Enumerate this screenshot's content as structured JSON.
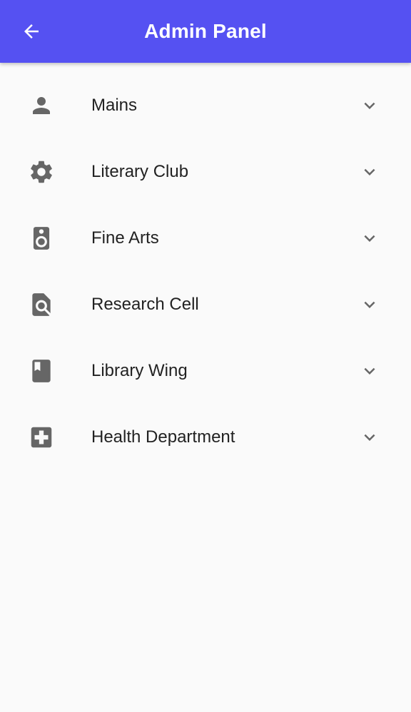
{
  "app_bar": {
    "title": "Admin Panel",
    "back_icon": "arrow-back-icon",
    "background": "#5551f2",
    "text_color": "#ffffff"
  },
  "menu": {
    "icon_color": "#666666",
    "items": [
      {
        "label": "Mains",
        "icon": "person-icon"
      },
      {
        "label": "Literary Club",
        "icon": "gear-icon"
      },
      {
        "label": "Fine Arts",
        "icon": "speaker-icon"
      },
      {
        "label": "Research Cell",
        "icon": "find-in-page-icon"
      },
      {
        "label": "Library Wing",
        "icon": "book-icon"
      },
      {
        "label": "Health Department",
        "icon": "medical-plus-icon"
      }
    ]
  }
}
